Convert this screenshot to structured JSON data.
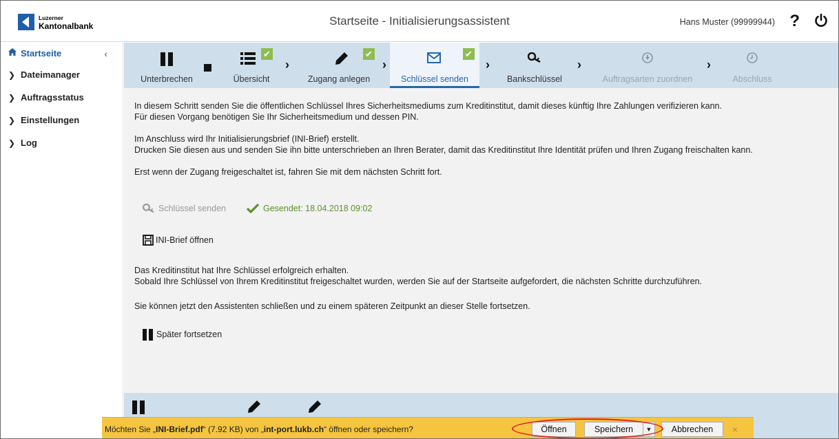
{
  "header": {
    "logo_line1": "Luzerner",
    "logo_line2": "Kantonalbank",
    "title": "Startseite - Initialisierungsassistent",
    "user": "Hans Muster (99999944)",
    "help": "?",
    "power_icon": "power-icon"
  },
  "sidebar": {
    "collapse": "‹",
    "items": [
      {
        "label": "Startseite",
        "icon": "home-icon"
      },
      {
        "label": "Dateimanager",
        "icon": "chevron-right-icon"
      },
      {
        "label": "Auftragsstatus",
        "icon": "chevron-right-icon"
      },
      {
        "label": "Einstellungen",
        "icon": "chevron-right-icon"
      },
      {
        "label": "Log",
        "icon": "chevron-right-icon"
      }
    ]
  },
  "steps": [
    {
      "label": "Unterbrechen",
      "icon": "pause-icon",
      "state": "normal"
    },
    {
      "label": "Übersicht",
      "icon": "list-icon",
      "state": "done"
    },
    {
      "label": "Zugang anlegen",
      "icon": "pencil-icon",
      "state": "done"
    },
    {
      "label": "Schlüssel senden",
      "icon": "envelope-icon",
      "state": "active"
    },
    {
      "label": "Bankschlüssel",
      "icon": "key-icon",
      "state": "normal"
    },
    {
      "label": "Auftragsarten zuordnen",
      "icon": "download-icon",
      "state": "disabled"
    },
    {
      "label": "Abschluss",
      "icon": "clock-icon",
      "state": "disabled"
    }
  ],
  "content": {
    "p1_line1": "In diesem Schritt senden Sie die öffentlichen Schlüssel Ihres Sicherheitsmediums zum Kreditinstitut, damit dieses künftig Ihre Zahlungen verifizieren kann.",
    "p1_line2": "Für diesen Vorgang benötigen Sie Ihr Sicherheitsmedium und dessen PIN.",
    "p2_line1": "Im Anschluss wird Ihr Initialisierungsbrief (INI-Brief) erstellt.",
    "p2_line2": "Drucken Sie diesen aus und senden Sie ihn bitte unterschrieben an Ihren Berater, damit das Kreditinstitut Ihre Identität prüfen und Ihren Zugang freischalten kann.",
    "p3": "Erst wenn der Zugang freigeschaltet ist, fahren Sie mit dem nächsten Schritt fort.",
    "send_key_label": "Schlüssel senden",
    "sent_status": "Gesendet: 18.04.2018 09:02",
    "open_ini_label": "INI-Brief öffnen",
    "p4_line1": "Das Kreditinstitut hat Ihre Schlüssel erfolgreich erhalten.",
    "p4_line2": "Sobald Ihre Schlüssel von Ihrem Kreditinstitut freigeschaltet wurden, werden Sie auf der Startseite aufgefordert, die nächsten Schritte durchzuführen.",
    "p5": "Sie können jetzt den Assistenten schließen und zu einem späteren Zeitpunkt an dieser Stelle fortsetzen.",
    "later_label": "Später fortsetzen"
  },
  "download_bar": {
    "prefix": "Möchten Sie „",
    "filename": "INI-Brief.pdf",
    "mid1": "“ (7.92 KB) von „",
    "host": "int-port.lukb.ch",
    "suffix": "“ öffnen oder speichern?",
    "open": "Öffnen",
    "save": "Speichern",
    "cancel": "Abbrechen",
    "close": "×"
  },
  "colors": {
    "accent": "#2467ad",
    "step_bar": "#cfdeeb",
    "check": "#8dbd4f",
    "download_bar": "#f5c540",
    "highlight": "#e21e1e"
  }
}
